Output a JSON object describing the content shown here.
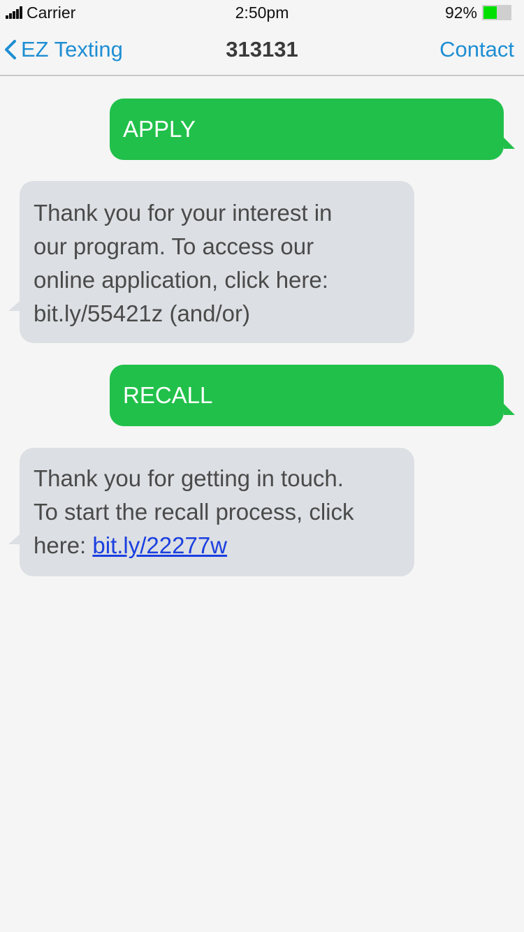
{
  "status_bar": {
    "carrier": "Carrier",
    "time": "2:50pm",
    "battery_percent": "92%",
    "battery_level": 0.5,
    "battery_color": "#00e000"
  },
  "nav": {
    "back_label": "EZ Texting",
    "title": "313131",
    "contact_label": "Contact",
    "accent_color": "#1e8ed3"
  },
  "messages": [
    {
      "direction": "outgoing",
      "text": "APPLY"
    },
    {
      "direction": "incoming",
      "lines": [
        "Thank you for your interest in",
        "our program. To access our",
        "online application, click here:",
        "bit.ly/55421z (and/or)"
      ]
    },
    {
      "direction": "outgoing",
      "text": "RECALL"
    },
    {
      "direction": "incoming",
      "lines": [
        "Thank you for getting in touch.",
        "To start the recall process, click"
      ],
      "last_line_prefix": "here: ",
      "link": "bit.ly/22277w"
    }
  ],
  "colors": {
    "outgoing_bubble": "#21c04a",
    "incoming_bubble": "#dcdfe3",
    "link": "#1a3fe0"
  }
}
